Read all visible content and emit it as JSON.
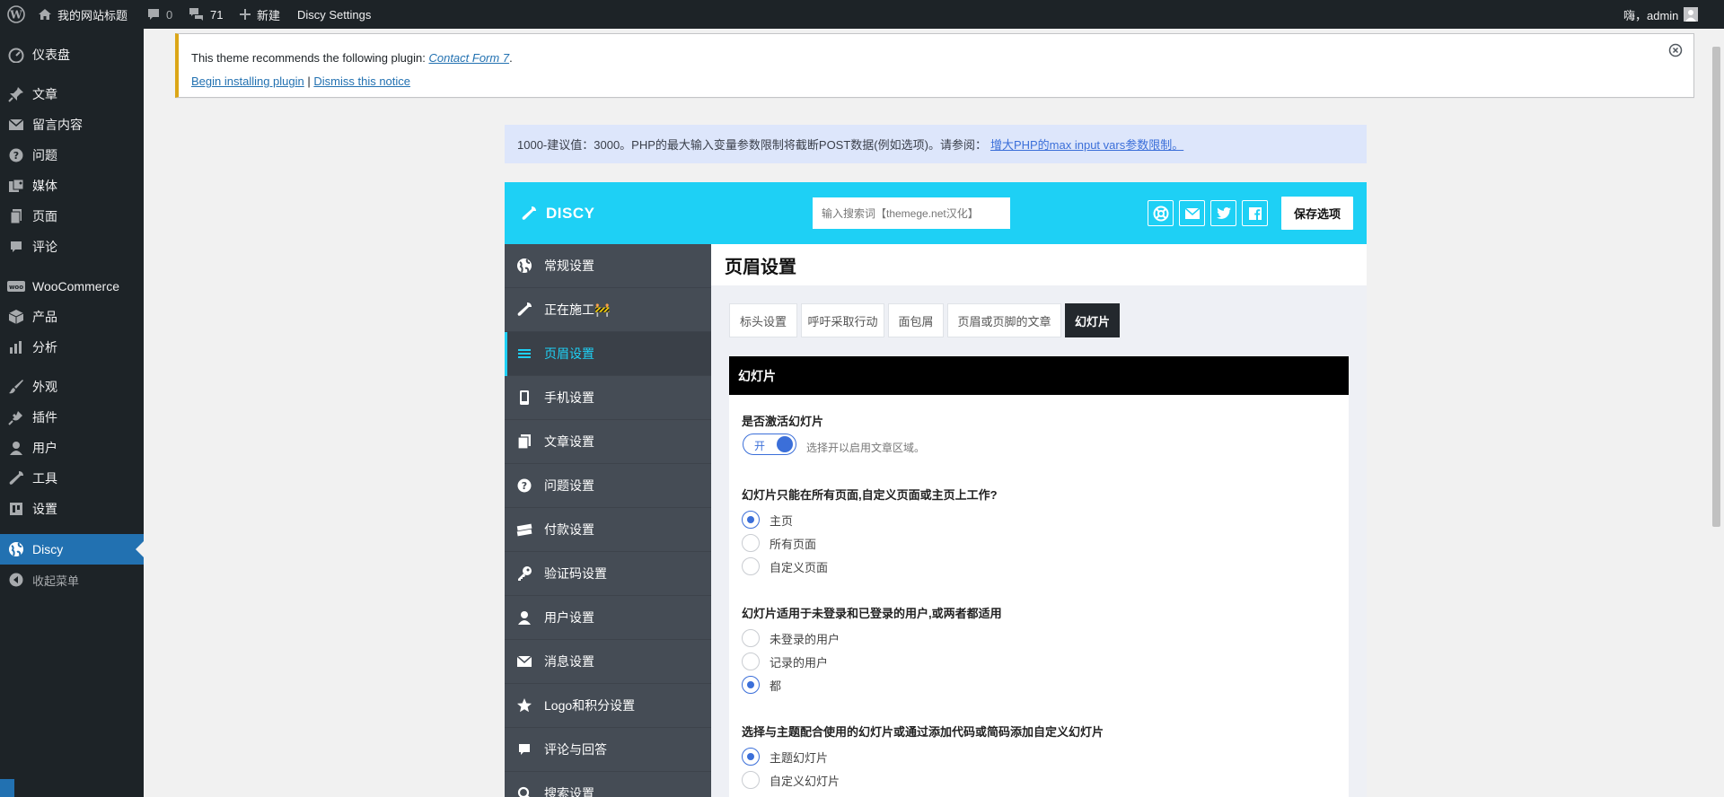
{
  "adminbar": {
    "site_name": "我的网站标题",
    "comments_count": "0",
    "updates_count": "71",
    "new_label": "新建",
    "settings_label": "Discy Settings",
    "greeting": "嗨，admin"
  },
  "adminmenu": {
    "items": [
      {
        "label": "仪表盘",
        "icon": "dashboard-icon"
      },
      {
        "label": "文章",
        "icon": "pin-icon"
      },
      {
        "label": "留言内容",
        "icon": "mail-icon"
      },
      {
        "label": "问题",
        "icon": "question-icon"
      },
      {
        "label": "媒体",
        "icon": "media-icon"
      },
      {
        "label": "页面",
        "icon": "page-icon"
      },
      {
        "label": "评论",
        "icon": "comment-icon"
      },
      {
        "label": "WooCommerce",
        "icon": "woo-icon"
      },
      {
        "label": "产品",
        "icon": "product-icon"
      },
      {
        "label": "分析",
        "icon": "chart-icon"
      },
      {
        "label": "外观",
        "icon": "brush-icon"
      },
      {
        "label": "插件",
        "icon": "plugin-icon"
      },
      {
        "label": "用户",
        "icon": "user-icon"
      },
      {
        "label": "工具",
        "icon": "wrench-icon"
      },
      {
        "label": "设置",
        "icon": "settings-icon"
      },
      {
        "label": "Discy",
        "icon": "globe-icon"
      },
      {
        "label": "收起菜单",
        "icon": "collapse-icon"
      }
    ]
  },
  "notice": {
    "text_before": "This theme recommends the following plugin: ",
    "plugin_link": "Contact Form 7",
    "text_after": ".",
    "install_link": "Begin installing plugin",
    "separator": " | ",
    "dismiss_link": "Dismiss this notice"
  },
  "infobar": {
    "text": "1000-建议值：3000。PHP的最大输入变量参数限制将截断POST数据(例如选项)。请参阅：",
    "link": "增大PHP的max input vars参数限制。"
  },
  "panel": {
    "brand": "DISCY",
    "search_placeholder": "输入搜索词【themege.net汉化】",
    "save_label": "保存选项",
    "accent": "#1ed0f5"
  },
  "theme_nav": {
    "items": [
      {
        "label": "常规设置",
        "icon": "globe-icon"
      },
      {
        "label": "正在施工🚧",
        "icon": "wrench-icon"
      },
      {
        "label": "页眉设置",
        "icon": "menu-icon"
      },
      {
        "label": "手机设置",
        "icon": "mobile-icon"
      },
      {
        "label": "文章设置",
        "icon": "copy-icon"
      },
      {
        "label": "问题设置",
        "icon": "question-icon"
      },
      {
        "label": "付款设置",
        "icon": "money-icon"
      },
      {
        "label": "验证码设置",
        "icon": "key-icon"
      },
      {
        "label": "用户设置",
        "icon": "user-icon"
      },
      {
        "label": "消息设置",
        "icon": "envelope-icon"
      },
      {
        "label": "Logo和积分设置",
        "icon": "star-icon"
      },
      {
        "label": "评论与回答",
        "icon": "comment-icon"
      },
      {
        "label": "搜索设置",
        "icon": "search-icon"
      }
    ]
  },
  "content": {
    "page_title": "页眉设置",
    "tabs": [
      "标头设置",
      "呼吁采取行动",
      "面包屑",
      "页眉或页脚的文章",
      "幻灯片"
    ],
    "section_title": "幻灯片",
    "field1": {
      "title": "是否激活幻灯片",
      "toggle_label": "开",
      "hint": "选择开以启用文章区域。"
    },
    "field2": {
      "title": "幻灯片只能在所有页面,自定义页面或主页上工作?",
      "options": [
        "主页",
        "所有页面",
        "自定义页面"
      ],
      "selected": "主页"
    },
    "field3": {
      "title": "幻灯片适用于未登录和已登录的用户,或两者都适用",
      "options": [
        "未登录的用户",
        "记录的用户",
        "都"
      ],
      "selected": "都"
    },
    "field4": {
      "title": "选择与主题配合使用的幻灯片或通过添加代码或简码添加自定义幻灯片",
      "options": [
        "主题幻灯片",
        "自定义幻灯片"
      ],
      "selected": "主题幻灯片"
    }
  }
}
